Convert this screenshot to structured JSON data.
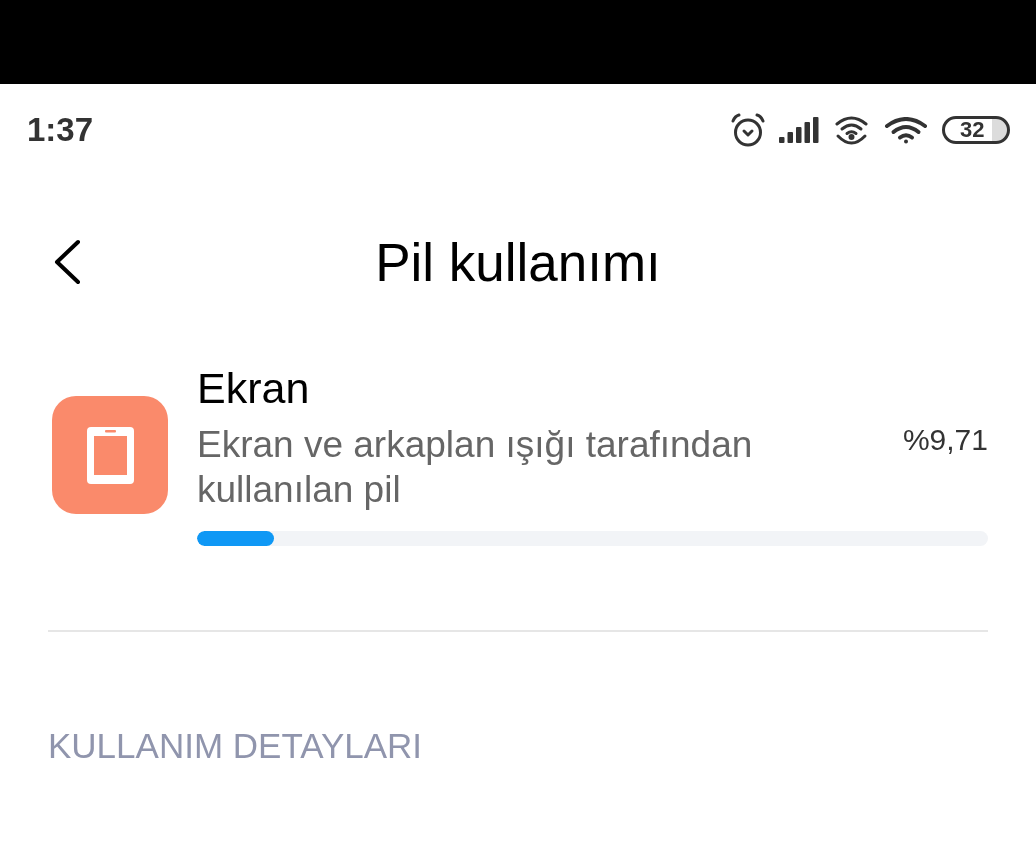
{
  "status_bar": {
    "time": "1:37",
    "battery": "32"
  },
  "header": {
    "title": "Pil kullanımı"
  },
  "usage_item": {
    "name": "Ekran",
    "description": "Ekran ve arkaplan ışığı tarafından kullanılan pil",
    "percentage": "%9,71",
    "level": 0.0971
  },
  "section": {
    "heading": "KULLANIM DETAYLARI"
  }
}
